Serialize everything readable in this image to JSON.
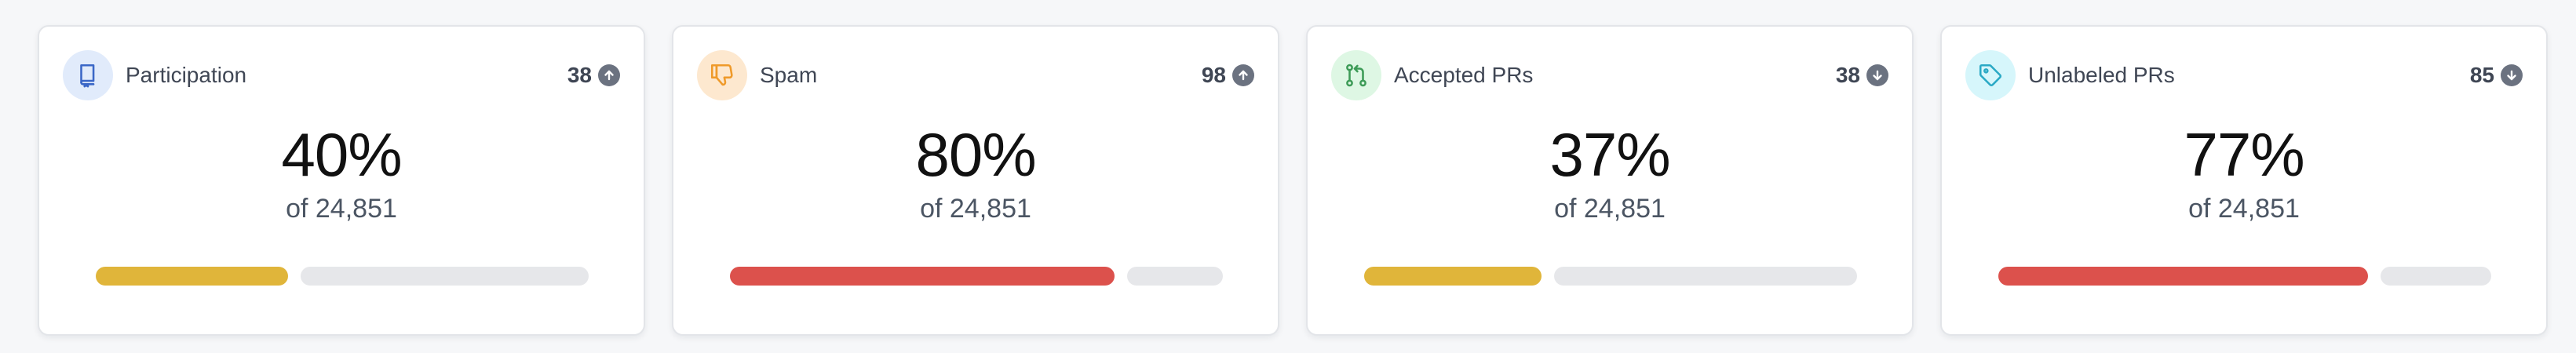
{
  "colors": {
    "yellow": "#e0b53a",
    "red": "#dc514c",
    "track": "#e6e7ea",
    "trend_icon": "#6b7280"
  },
  "cards": [
    {
      "title": "Participation",
      "icon": "repo-icon",
      "icon_bg": "#e1ebfb",
      "icon_color": "#3b67c7",
      "count": "38",
      "trend": "up",
      "value": "40%",
      "subtitle": "of 24,851",
      "progress": 0.4,
      "bar_color": "#e0b53a"
    },
    {
      "title": "Spam",
      "icon": "thumbs-down-icon",
      "icon_bg": "#fde8cf",
      "icon_color": "#ef9a2a",
      "count": "98",
      "trend": "up",
      "value": "80%",
      "subtitle": "of 24,851",
      "progress": 0.8,
      "bar_color": "#dc514c"
    },
    {
      "title": "Accepted PRs",
      "icon": "git-pull-request-icon",
      "icon_bg": "#def7e4",
      "icon_color": "#3d9b57",
      "count": "38",
      "trend": "down",
      "value": "37%",
      "subtitle": "of 24,851",
      "progress": 0.37,
      "bar_color": "#e0b53a"
    },
    {
      "title": "Unlabeled PRs",
      "icon": "tag-icon",
      "icon_bg": "#d6f6fb",
      "icon_color": "#2aa9c5",
      "count": "85",
      "trend": "down",
      "value": "77%",
      "subtitle": "of 24,851",
      "progress": 0.77,
      "bar_color": "#dc514c"
    }
  ]
}
